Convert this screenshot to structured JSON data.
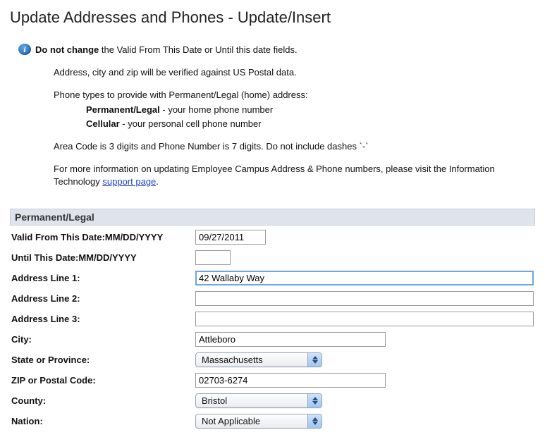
{
  "page_title": "Update Addresses and Phones - Update/Insert",
  "notice": {
    "warn_bold": "Do not change",
    "warn_rest": " the Valid From This Date or Until this date fields.",
    "verify": "Address, city and zip will be verified against US Postal data.",
    "phone_intro": "Phone types to provide with Permanent/Legal (home) address:",
    "pl_label": "Permanent/Legal",
    "pl_desc": " - your home phone number",
    "cell_label": "Cellular",
    "cell_desc": " - your personal cell phone number",
    "areacode": "Area Code is 3 digits and Phone Number is 7 digits. Do not include dashes `-`",
    "more_pre": "For more information on updating Employee Campus Address & Phone numbers, please visit the Information Technology ",
    "more_link": "support page",
    "more_post": "."
  },
  "section_header": "Permanent/Legal",
  "labels": {
    "valid_from": "Valid From This Date:MM/DD/YYYY",
    "until": "Until This Date:MM/DD/YYYY",
    "addr1": "Address Line 1:",
    "addr2": "Address Line 2:",
    "addr3": "Address Line 3:",
    "city": "City:",
    "state": "State or Province:",
    "zip": "ZIP or Postal Code:",
    "county": "County:",
    "nation": "Nation:"
  },
  "values": {
    "valid_from": "09/27/2011",
    "until": "",
    "addr1": "42 Wallaby Way",
    "addr2": "",
    "addr3": "",
    "city": "Attleboro",
    "state": "Massachusetts",
    "zip": "02703-6274",
    "county": "Bristol",
    "nation": "Not Applicable"
  }
}
